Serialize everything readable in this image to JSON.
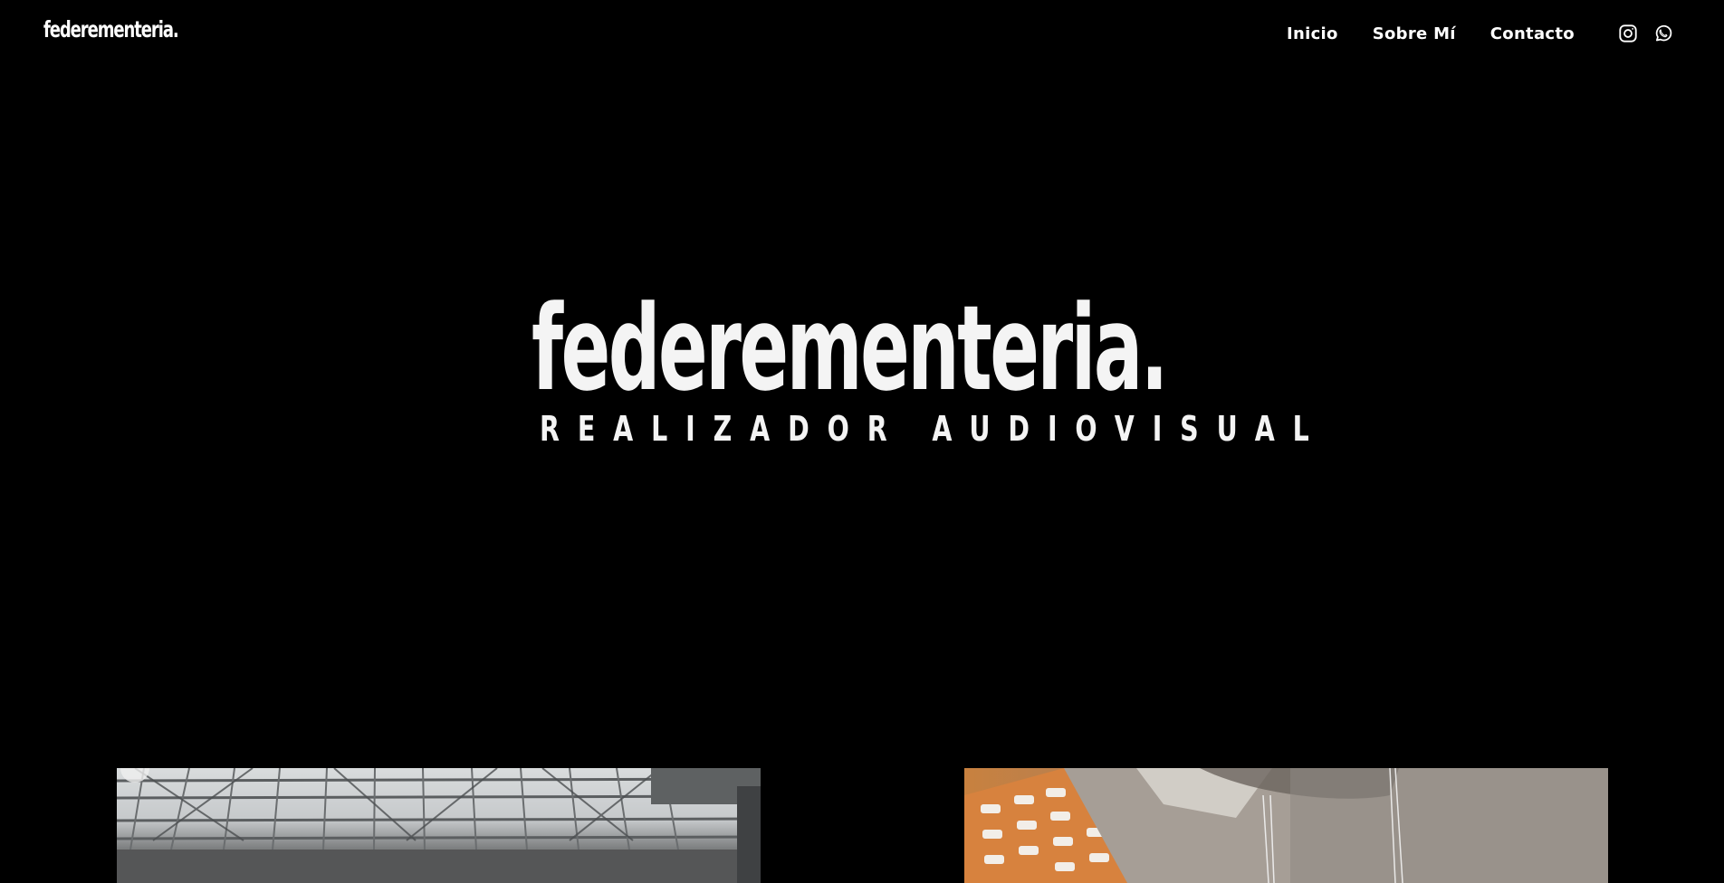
{
  "header": {
    "brand": "federementeria.",
    "nav": [
      {
        "label": "Inicio"
      },
      {
        "label": "Sobre Mí"
      },
      {
        "label": "Contacto"
      }
    ],
    "social": [
      {
        "icon": "instagram-icon"
      },
      {
        "icon": "whatsapp-icon"
      }
    ]
  },
  "hero": {
    "title": "federementeria.",
    "subtitle": "REALIZADOR AUDIOVISUAL"
  },
  "colors": {
    "background": "#000000",
    "text": "#ffffff"
  }
}
